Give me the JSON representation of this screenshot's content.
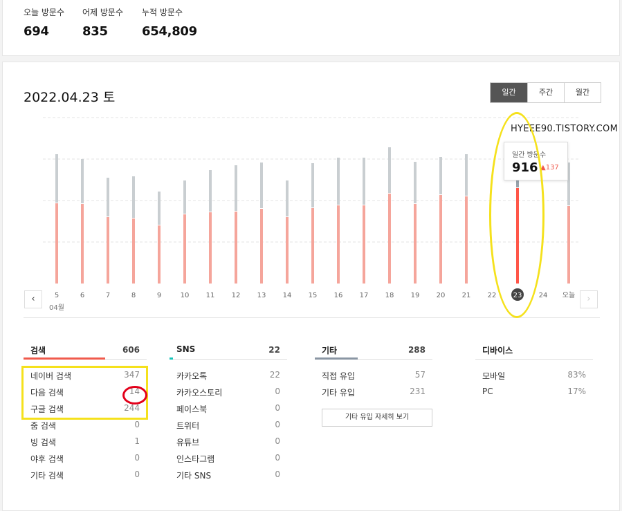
{
  "summary": {
    "today_label": "오늘 방문수",
    "today_value": "694",
    "yesterday_label": "어제 방문수",
    "yesterday_value": "835",
    "total_label": "누적 방문수",
    "total_value": "654,809"
  },
  "date_title": "2022.04.23 토",
  "period_tabs": [
    "일간",
    "주간",
    "월간"
  ],
  "watermark": "HYEEE90.TISTORY.COM",
  "tooltip": {
    "label": "일간 방문수",
    "value": "916",
    "diff": "137"
  },
  "month_label": "04월",
  "colors": {
    "gray_bar": "#c9ced1",
    "red_bar": "#f5a59b",
    "active_gray": "#97a2ab",
    "active_red": "#ff5648",
    "highlight_yellow": "#f5e11c",
    "highlight_red": "#e3001a"
  },
  "chart_data": {
    "type": "bar",
    "stacked": true,
    "categories": [
      "5",
      "6",
      "7",
      "8",
      "9",
      "10",
      "11",
      "12",
      "13",
      "14",
      "15",
      "16",
      "17",
      "18",
      "19",
      "20",
      "21",
      "22",
      "23",
      "24",
      "오늘"
    ],
    "selected_index": 18,
    "series": [
      {
        "values": [
          580,
          575,
          480,
          470,
          420,
          500,
          515,
          520,
          540,
          480,
          545,
          565,
          565,
          650,
          575,
          640,
          630,
          0,
          690,
          0,
          560
        ]
      },
      {
        "values": [
          350,
          320,
          280,
          300,
          240,
          240,
          300,
          330,
          330,
          260,
          320,
          340,
          340,
          330,
          300,
          270,
          300,
          0,
          226,
          0,
          310
        ]
      }
    ],
    "ylim": [
      0,
      1200
    ],
    "grid": true
  },
  "stats": {
    "search": {
      "title": "검색",
      "total": "606",
      "accent": "#f05a4c",
      "rows": [
        {
          "label": "네이버 검색",
          "value": "347"
        },
        {
          "label": "다음 검색",
          "value": "14"
        },
        {
          "label": "구글 검색",
          "value": "244"
        },
        {
          "label": "줌 검색",
          "value": "0"
        },
        {
          "label": "빙 검색",
          "value": "1"
        },
        {
          "label": "야후 검색",
          "value": "0"
        },
        {
          "label": "기타 검색",
          "value": "0"
        }
      ]
    },
    "sns": {
      "title": "SNS",
      "total": "22",
      "accent": "#18c3b8",
      "rows": [
        {
          "label": "카카오톡",
          "value": "22"
        },
        {
          "label": "카카오스토리",
          "value": "0"
        },
        {
          "label": "페이스북",
          "value": "0"
        },
        {
          "label": "트위터",
          "value": "0"
        },
        {
          "label": "유튜브",
          "value": "0"
        },
        {
          "label": "인스타그램",
          "value": "0"
        },
        {
          "label": "기타 SNS",
          "value": "0"
        }
      ]
    },
    "etc": {
      "title": "기타",
      "total": "288",
      "accent": "#8a96a3",
      "rows": [
        {
          "label": "직접 유입",
          "value": "57"
        },
        {
          "label": "기타 유입",
          "value": "231"
        }
      ],
      "detail_button": "기타 유입 자세히 보기"
    },
    "device": {
      "title": "디바이스",
      "rows": [
        {
          "label": "모바일",
          "value": "83%"
        },
        {
          "label": "PC",
          "value": "17%"
        }
      ]
    }
  }
}
